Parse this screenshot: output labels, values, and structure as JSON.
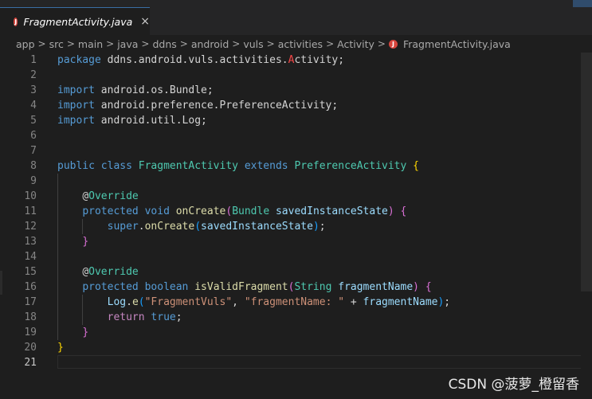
{
  "tab": {
    "title": "FragmentActivity.java",
    "icon": "java-file-icon",
    "close": "×"
  },
  "breadcrumb": {
    "items": [
      "app",
      "src",
      "main",
      "java",
      "ddns",
      "android",
      "vuls",
      "activities",
      "Activity"
    ],
    "file": "FragmentActivity.java",
    "separator": ">"
  },
  "editor": {
    "language": "java",
    "current_line": 21,
    "lines": [
      {
        "n": "1",
        "tokens": [
          {
            "t": "package",
            "c": "kw"
          },
          {
            "t": " ddns.android.vuls.activities.",
            "c": "pl"
          },
          {
            "t": "A",
            "c": "cap"
          },
          {
            "t": "ctivity;",
            "c": "pl"
          }
        ]
      },
      {
        "n": "2",
        "tokens": []
      },
      {
        "n": "3",
        "tokens": [
          {
            "t": "import",
            "c": "kw"
          },
          {
            "t": " android.os.Bundle;",
            "c": "pl"
          }
        ]
      },
      {
        "n": "4",
        "tokens": [
          {
            "t": "import",
            "c": "kw"
          },
          {
            "t": " android.preference.PreferenceActivity;",
            "c": "pl"
          }
        ]
      },
      {
        "n": "5",
        "tokens": [
          {
            "t": "import",
            "c": "kw"
          },
          {
            "t": " android.util.Log;",
            "c": "pl"
          }
        ]
      },
      {
        "n": "6",
        "tokens": []
      },
      {
        "n": "7",
        "tokens": []
      },
      {
        "n": "8",
        "tokens": [
          {
            "t": "public",
            "c": "kw"
          },
          {
            "t": " ",
            "c": "pl"
          },
          {
            "t": "class",
            "c": "kw"
          },
          {
            "t": " ",
            "c": "pl"
          },
          {
            "t": "FragmentActivity",
            "c": "ty"
          },
          {
            "t": " ",
            "c": "pl"
          },
          {
            "t": "extends",
            "c": "kw"
          },
          {
            "t": " ",
            "c": "pl"
          },
          {
            "t": "PreferenceActivity",
            "c": "ty"
          },
          {
            "t": " ",
            "c": "pl"
          },
          {
            "t": "{",
            "c": "br1"
          }
        ]
      },
      {
        "n": "9",
        "tokens": []
      },
      {
        "n": "10",
        "tokens": [
          {
            "t": "    ",
            "c": "pl"
          },
          {
            "t": "@",
            "c": "pl"
          },
          {
            "t": "Override",
            "c": "ty"
          }
        ]
      },
      {
        "n": "11",
        "tokens": [
          {
            "t": "    ",
            "c": "pl"
          },
          {
            "t": "protected",
            "c": "kw"
          },
          {
            "t": " ",
            "c": "pl"
          },
          {
            "t": "void",
            "c": "kw"
          },
          {
            "t": " ",
            "c": "pl"
          },
          {
            "t": "onCreate",
            "c": "fn"
          },
          {
            "t": "(",
            "c": "br2"
          },
          {
            "t": "Bundle",
            "c": "ty"
          },
          {
            "t": " ",
            "c": "pl"
          },
          {
            "t": "savedInstanceState",
            "c": "var"
          },
          {
            "t": ")",
            "c": "br2"
          },
          {
            "t": " ",
            "c": "pl"
          },
          {
            "t": "{",
            "c": "br2"
          }
        ]
      },
      {
        "n": "12",
        "tokens": [
          {
            "t": "        ",
            "c": "pl"
          },
          {
            "t": "super",
            "c": "kw"
          },
          {
            "t": ".",
            "c": "pl"
          },
          {
            "t": "onCreate",
            "c": "fn"
          },
          {
            "t": "(",
            "c": "br3"
          },
          {
            "t": "savedInstanceState",
            "c": "var"
          },
          {
            "t": ")",
            "c": "br3"
          },
          {
            "t": ";",
            "c": "pl"
          }
        ]
      },
      {
        "n": "13",
        "tokens": [
          {
            "t": "    ",
            "c": "pl"
          },
          {
            "t": "}",
            "c": "br2"
          }
        ]
      },
      {
        "n": "14",
        "tokens": []
      },
      {
        "n": "15",
        "tokens": [
          {
            "t": "    ",
            "c": "pl"
          },
          {
            "t": "@",
            "c": "pl"
          },
          {
            "t": "Override",
            "c": "ty"
          }
        ]
      },
      {
        "n": "16",
        "tokens": [
          {
            "t": "    ",
            "c": "pl"
          },
          {
            "t": "protected",
            "c": "kw"
          },
          {
            "t": " ",
            "c": "pl"
          },
          {
            "t": "boolean",
            "c": "kw"
          },
          {
            "t": " ",
            "c": "pl"
          },
          {
            "t": "isValidFragment",
            "c": "fn"
          },
          {
            "t": "(",
            "c": "br2"
          },
          {
            "t": "String",
            "c": "ty"
          },
          {
            "t": " ",
            "c": "pl"
          },
          {
            "t": "fragmentName",
            "c": "var"
          },
          {
            "t": ")",
            "c": "br2"
          },
          {
            "t": " ",
            "c": "pl"
          },
          {
            "t": "{",
            "c": "br2"
          }
        ]
      },
      {
        "n": "17",
        "tokens": [
          {
            "t": "        ",
            "c": "pl"
          },
          {
            "t": "Log",
            "c": "var"
          },
          {
            "t": ".",
            "c": "pl"
          },
          {
            "t": "e",
            "c": "fn"
          },
          {
            "t": "(",
            "c": "br3"
          },
          {
            "t": "\"FragmentVuls\"",
            "c": "str"
          },
          {
            "t": ", ",
            "c": "pl"
          },
          {
            "t": "\"fragmentName: \"",
            "c": "str"
          },
          {
            "t": " + ",
            "c": "pl"
          },
          {
            "t": "fragmentName",
            "c": "var"
          },
          {
            "t": ")",
            "c": "br3"
          },
          {
            "t": ";",
            "c": "pl"
          }
        ]
      },
      {
        "n": "18",
        "tokens": [
          {
            "t": "        ",
            "c": "pl"
          },
          {
            "t": "return",
            "c": "ctl"
          },
          {
            "t": " ",
            "c": "pl"
          },
          {
            "t": "true",
            "c": "kw"
          },
          {
            "t": ";",
            "c": "pl"
          }
        ]
      },
      {
        "n": "19",
        "tokens": [
          {
            "t": "    ",
            "c": "pl"
          },
          {
            "t": "}",
            "c": "br2"
          }
        ]
      },
      {
        "n": "20",
        "tokens": [
          {
            "t": "}",
            "c": "br1"
          }
        ]
      },
      {
        "n": "21",
        "tokens": []
      }
    ]
  },
  "watermark": "CSDN @菠萝_橙留香"
}
